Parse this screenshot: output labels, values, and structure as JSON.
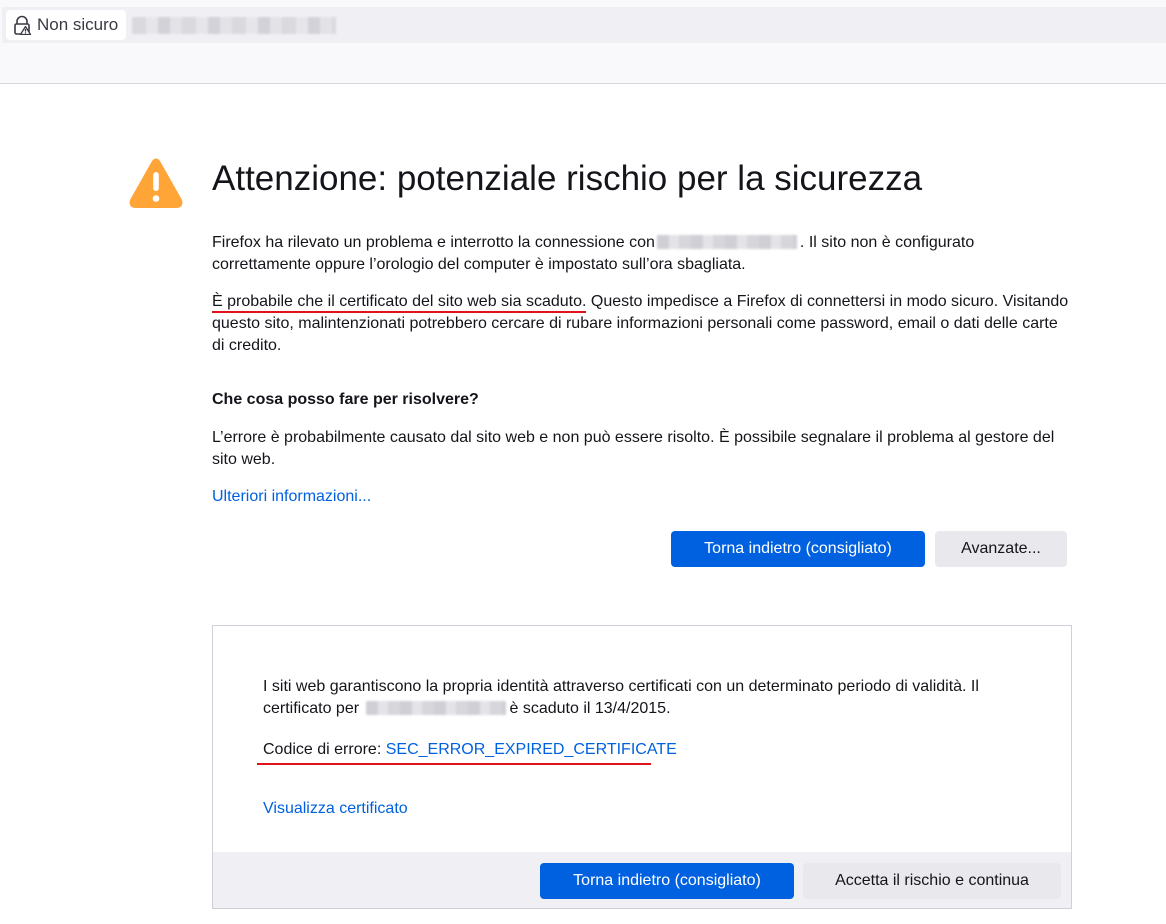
{
  "urlbar": {
    "identity_label": "Non sicuro"
  },
  "page": {
    "title": "Attenzione: potenziale rischio per la sicurezza",
    "p1_before": "Firefox ha rilevato un problema e interrotto la connessione con",
    "p1_after": ". Il sito non è configurato correttamente oppure l’orologio del computer è impostato sull’ora sbagliata.",
    "p2_underlined": "È probabile che il certificato del sito web sia scaduto.",
    "p2_rest": " Questo impedisce a Firefox di connettersi in modo sicuro. Visitando questo sito, malintenzionati potrebbero cercare di rubare informazioni personali come password, email o dati delle carte di credito.",
    "help_heading": "Che cosa posso fare per risolvere?",
    "help_text": "L’errore è probabilmente causato dal sito web e non può essere risolto. È possibile segnalare il problema al gestore del sito web.",
    "learn_more_link": "Ulteriori informazioni...",
    "back_button": "Torna indietro (consigliato)",
    "advanced_button": "Avanzate..."
  },
  "advanced": {
    "text_before": "I siti web garantiscono la propria identità attraverso certificati con un determinato periodo di validità. Il certificato per",
    "text_after": "è scaduto il 13/4/2015.",
    "error_label": "Codice di errore: ",
    "error_code": "SEC_ERROR_EXPIRED_CERTIFICATE",
    "view_cert_link": "Visualizza certificato",
    "back_button": "Torna indietro (consigliato)",
    "accept_button": "Accetta il rischio e continua"
  },
  "colors": {
    "accent": "#0061e0",
    "warning": "#ffa436",
    "annotation_red": "#e0121b"
  },
  "icons": {
    "identity": "lock-warning-icon",
    "page": "warning-triangle-icon"
  }
}
